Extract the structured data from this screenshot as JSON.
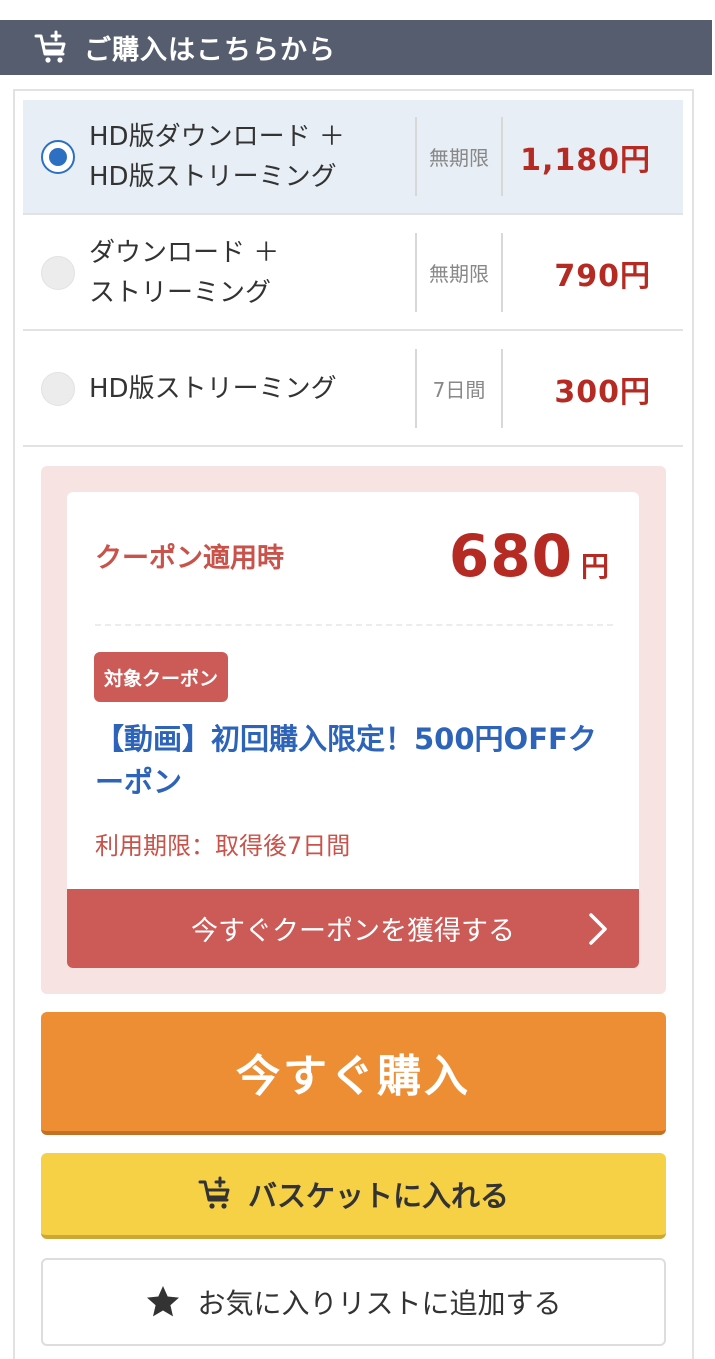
{
  "header": {
    "title": "ご購入はこちらから",
    "icon": "cart-add-icon"
  },
  "options": [
    {
      "label": "HD版ダウンロード ＋\nHD版ストリーミング",
      "term": "無期限",
      "price": "1,180円",
      "selected": true
    },
    {
      "label": "ダウンロード ＋\nストリーミング",
      "term": "無期限",
      "price": "790円",
      "selected": false
    },
    {
      "label": "HD版ストリーミング",
      "term": "7日間",
      "price": "300円",
      "selected": false
    }
  ],
  "coupon": {
    "label": "クーポン適用時",
    "price": "680",
    "yen": "円",
    "badge": "対象クーポン",
    "name": "【動画】初回購入限定！500円OFFクーポン",
    "limit": "利用期限：取得後7日間",
    "get_button": "今すぐクーポンを獲得する"
  },
  "buttons": {
    "buy_now": "今すぐ購入",
    "basket": "バスケットに入れる",
    "favorite": "お気に入りリストに追加する"
  },
  "colors": {
    "header_bg": "#565d6e",
    "price_red": "#b52a22",
    "selected_bg": "#e7eef6",
    "radio_blue": "#2d6fc2",
    "coupon_bg": "#f8e3e3",
    "coupon_accent": "#cc5b58",
    "coupon_link": "#2d63b8",
    "buy_orange": "#ee8e34",
    "basket_yellow": "#f6d045"
  }
}
